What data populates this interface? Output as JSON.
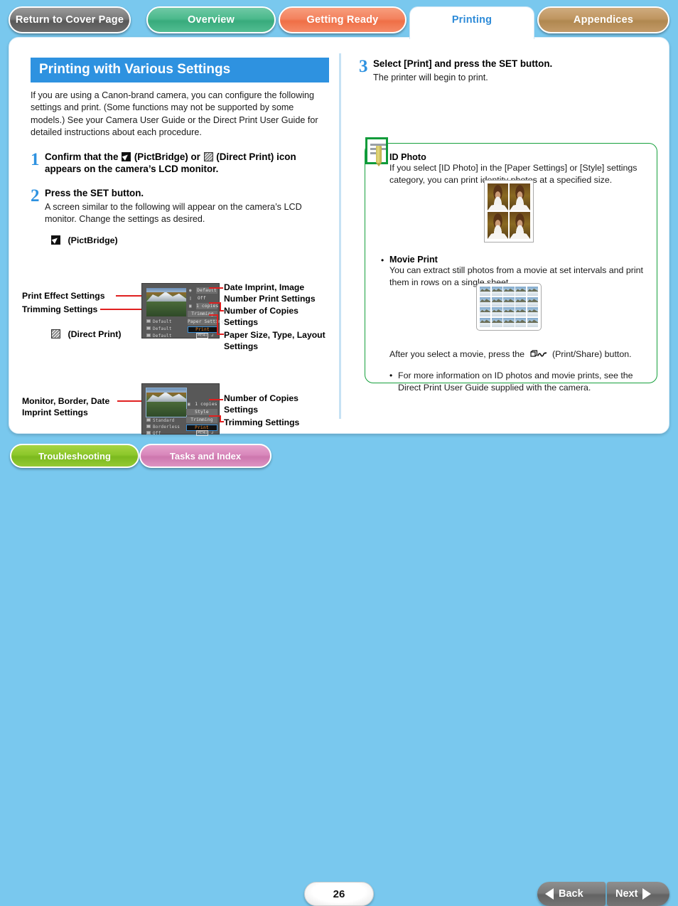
{
  "tabs": [
    {
      "id": "cover",
      "label": "Return to Cover Page",
      "color": "#787878"
    },
    {
      "id": "overview",
      "label": "Overview",
      "color": "#4bb98c"
    },
    {
      "id": "getting_ready",
      "label": "Getting Ready",
      "color": "#f3825e"
    },
    {
      "id": "printing",
      "label": "Printing",
      "color": "#2e8bd8",
      "active": true
    },
    {
      "id": "appendices",
      "label": "Appendices",
      "color": "#bf9660"
    }
  ],
  "left": {
    "section_title": "Printing with Various Settings",
    "intro": "If you are using a Canon-brand camera, you can configure the following settings and print. (Some functions may not be supported by some models.) See your Camera User Guide or the Direct Print User Guide for detailed instructions about each procedure.",
    "step1": {
      "num": "1",
      "head_a": "Confirm that the ",
      "head_b": " (PictBridge) or ",
      "head_c": " (Direct Print) icon appears on the camera’s LCD monitor."
    },
    "step2": {
      "num": "2",
      "head": "Press the SET button.",
      "sub": "A screen similar to the following will appear on the camera’s LCD monitor. Change the settings as desired."
    },
    "mode_pictbridge": "(PictBridge)",
    "mode_directprint": "(Direct Print)",
    "callouts_pictbridge": {
      "left": [
        "Print Effect Settings",
        "Trimming Settings"
      ],
      "right": [
        "Date Imprint, Image Number Print Settings",
        "Number of Copies Settings",
        "Paper Size, Type, Layout Settings"
      ]
    },
    "callouts_directprint": {
      "left": [
        "Monitor, Border, Date Imprint Settings"
      ],
      "right": [
        "Number of Copies Settings",
        "Trimming Settings"
      ]
    },
    "lcd_pictbridge": {
      "rows_right": [
        "Default",
        "Off",
        "1 copies",
        "Trimming",
        "Paper Settings"
      ],
      "print_button": "Print",
      "menu": "MENU",
      "rows_left": [
        "Default",
        "Default",
        "Default"
      ]
    },
    "lcd_directprint": {
      "rows_right": [
        "1 copies",
        "Style",
        "Trimming"
      ],
      "print_button": "Print",
      "menu": "MENU",
      "rows_left": [
        "Standard",
        "Borderless",
        "Off"
      ]
    }
  },
  "right": {
    "step3": {
      "num": "3",
      "head": "Select [Print] and press the SET button.",
      "sub": "The printer will begin to print."
    },
    "note": {
      "border_color": "#16a03c",
      "items": [
        {
          "title": "ID Photo",
          "text": "If you select [ID Photo] in the [Paper Settings] or [Style] settings category, you can print identity photos at a specified size."
        },
        {
          "title": "Movie Print",
          "text": "You can extract still photos from a movie at set intervals and print them in rows on a single sheet."
        }
      ],
      "after_movie_a": "After you select a movie, press the",
      "after_movie_b": "(Print/Share) button.",
      "footnote": "For more information on ID photos and movie prints, see the Direct Print User Guide supplied with the camera."
    }
  },
  "bottom": {
    "troubleshooting": "Troubleshooting",
    "tasks_index": "Tasks and Index",
    "page_number": "26",
    "back": "Back",
    "next": "Next"
  }
}
